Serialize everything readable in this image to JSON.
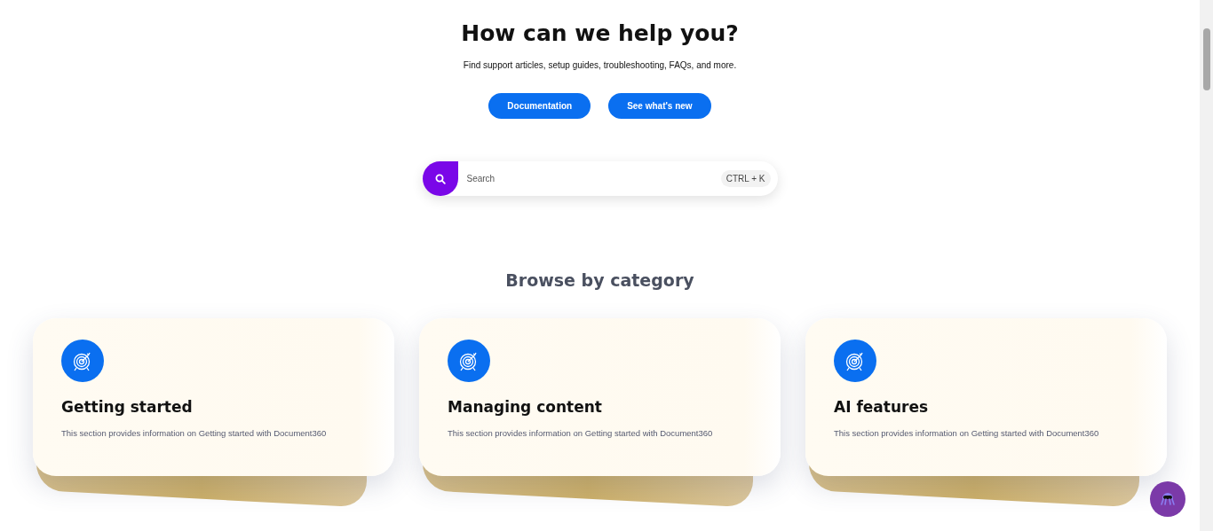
{
  "hero": {
    "title": "How can we help you?",
    "subtitle": "Find support articles, setup guides, troubleshooting, FAQs, and more.",
    "buttons": [
      "Documentation",
      "See what's new"
    ]
  },
  "search": {
    "placeholder": "Search",
    "shortcut": "CTRL + K"
  },
  "categories": {
    "heading": "Browse by category",
    "cards": [
      {
        "title": "Getting started",
        "description": "This section provides information on Getting started with Document360"
      },
      {
        "title": "Managing content",
        "description": "This section provides information on Getting started with Document360"
      },
      {
        "title": "AI features",
        "description": "This section provides information on Getting started with Document360"
      }
    ]
  }
}
